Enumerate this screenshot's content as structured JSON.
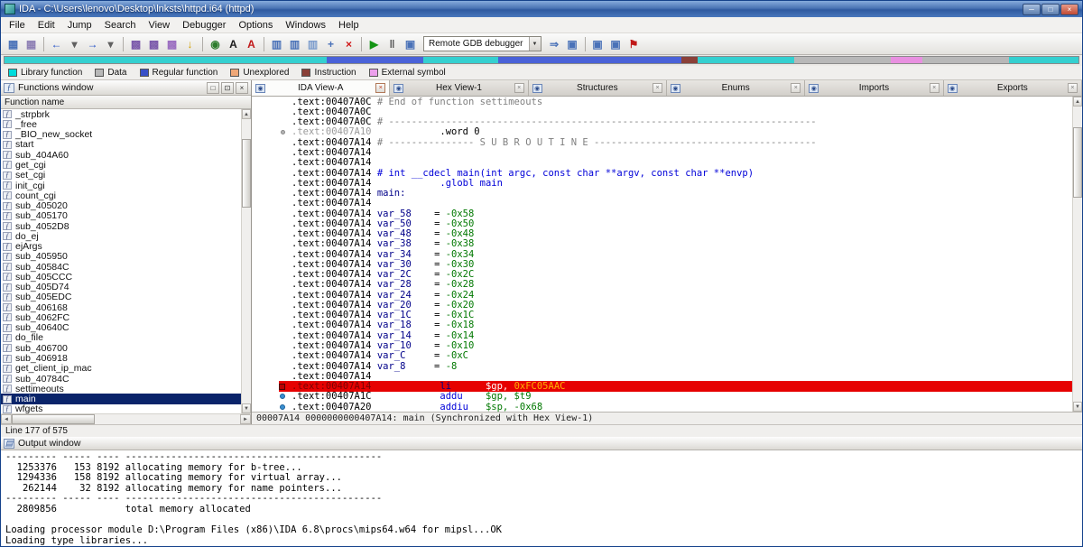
{
  "window": {
    "title": "IDA - C:\\Users\\lenovo\\Desktop\\lnksts\\httpd.i64 (httpd)",
    "controls": [
      {
        "name": "minimize-button",
        "glyph": "─"
      },
      {
        "name": "maximize-button",
        "glyph": "□"
      },
      {
        "name": "close-button",
        "glyph": "×"
      }
    ]
  },
  "menu": {
    "items": [
      "File",
      "Edit",
      "Jump",
      "Search",
      "View",
      "Debugger",
      "Options",
      "Windows",
      "Help"
    ]
  },
  "toolbar": {
    "debugger_combo": {
      "label": "Remote GDB debugger",
      "arrow": "▼"
    },
    "items": [
      {
        "name": "open-database-icon",
        "glyph": "▦",
        "color": "#4a72b8"
      },
      {
        "name": "save-database-icon",
        "glyph": "▦",
        "color": "#8d7fb4"
      },
      {
        "name": "sep"
      },
      {
        "name": "back-icon",
        "glyph": "←",
        "color": "#2050c8"
      },
      {
        "name": "back-dropdown-icon",
        "glyph": "▾",
        "color": "#606060"
      },
      {
        "name": "forward-icon",
        "glyph": "→",
        "color": "#2050c8"
      },
      {
        "name": "forward-dropdown-icon",
        "glyph": "▾",
        "color": "#606060"
      },
      {
        "name": "sep"
      },
      {
        "name": "segments-icon",
        "glyph": "▩",
        "color": "#7a58aa"
      },
      {
        "name": "names-icon",
        "glyph": "▩",
        "color": "#7a58aa"
      },
      {
        "name": "functions-list-icon",
        "glyph": "▩",
        "color": "#9a6cc0"
      },
      {
        "name": "jump-address-icon",
        "glyph": "↓",
        "color": "#d2a000"
      },
      {
        "name": "sep"
      },
      {
        "name": "graph-view-icon",
        "glyph": "◉",
        "color": "#2d7d2d"
      },
      {
        "name": "text-view-icon",
        "glyph": "A",
        "color": "#1a1a1a"
      },
      {
        "name": "strings-icon",
        "glyph": "A",
        "color": "#c01818"
      },
      {
        "name": "sep"
      },
      {
        "name": "chart-flow-icon",
        "glyph": "▥",
        "color": "#4a72b8"
      },
      {
        "name": "chart-calls-icon",
        "glyph": "▥",
        "color": "#4a72b8"
      },
      {
        "name": "chart-xrefs-icon",
        "glyph": "▥",
        "color": "#7c9ccc"
      },
      {
        "name": "add-structure-icon",
        "glyph": "+",
        "color": "#4a72b8"
      },
      {
        "name": "cancel-icon",
        "glyph": "×",
        "color": "#d01818"
      },
      {
        "name": "sep"
      },
      {
        "name": "run-debugger-icon",
        "glyph": "▶",
        "color": "#149414"
      },
      {
        "name": "pause-debugger-icon",
        "glyph": "‖",
        "color": "#555555"
      },
      {
        "name": "stop-debugger-icon",
        "glyph": "▣",
        "color": "#4a72b8"
      },
      {
        "name": "combo"
      },
      {
        "name": "step-into-icon",
        "glyph": "⇒",
        "color": "#4a72b8"
      },
      {
        "name": "debugger-windows-icon",
        "glyph": "▣",
        "color": "#4a72b8"
      },
      {
        "name": "sep"
      },
      {
        "name": "breakpoints-icon",
        "glyph": "▣",
        "color": "#4a72b8"
      },
      {
        "name": "watches-icon",
        "glyph": "▣",
        "color": "#4a72b8"
      },
      {
        "name": "flag-icon",
        "glyph": "⚑",
        "color": "#c01818"
      }
    ]
  },
  "navband": {
    "segments": [
      {
        "color": "#35d0d0",
        "width": 30
      },
      {
        "color": "#4a62d8",
        "width": 9
      },
      {
        "color": "#35d0d0",
        "width": 7
      },
      {
        "color": "#4a62d8",
        "width": 17
      },
      {
        "color": "#8a4038",
        "width": 1.5
      },
      {
        "color": "#35d0d0",
        "width": 9
      },
      {
        "color": "#b8b8b8",
        "width": 9
      },
      {
        "color": "#e890e0",
        "width": 3
      },
      {
        "color": "#b8b8b8",
        "width": 8
      },
      {
        "color": "#35d0d0",
        "width": 6.5
      }
    ]
  },
  "legend": {
    "items": [
      {
        "label": "Library function",
        "color": "#00dcdc"
      },
      {
        "label": "Data",
        "color": "#b8b8b8"
      },
      {
        "label": "Regular function",
        "color": "#3850c8"
      },
      {
        "label": "Unexplored",
        "color": "#f0a878"
      },
      {
        "label": "Instruction",
        "color": "#8a4038"
      },
      {
        "label": "External symbol",
        "color": "#eca0ec"
      }
    ]
  },
  "scroll": {
    "up": "▲",
    "down": "▼",
    "left": "◄",
    "right": "►"
  },
  "functions": {
    "icon": "ƒ",
    "title": "Functions window",
    "buttons": [
      {
        "name": "dock-button",
        "glyph": "□"
      },
      {
        "name": "restore-button",
        "glyph": "⊡"
      },
      {
        "name": "close-button",
        "glyph": "×"
      }
    ],
    "column_header": "Function name",
    "status": "Line 177 of 575",
    "items": [
      {
        "label": "_strpbrk"
      },
      {
        "label": "_free"
      },
      {
        "label": "_BIO_new_socket"
      },
      {
        "label": "start"
      },
      {
        "label": "sub_404A60"
      },
      {
        "label": "get_cgi"
      },
      {
        "label": "set_cgi"
      },
      {
        "label": "init_cgi"
      },
      {
        "label": "count_cgi"
      },
      {
        "label": "sub_405020"
      },
      {
        "label": "sub_405170"
      },
      {
        "label": "sub_4052D8"
      },
      {
        "label": "do_ej"
      },
      {
        "label": "ejArgs"
      },
      {
        "label": "sub_405950"
      },
      {
        "label": "sub_40584C"
      },
      {
        "label": "sub_405CCC"
      },
      {
        "label": "sub_405D74"
      },
      {
        "label": "sub_405EDC"
      },
      {
        "label": "sub_406168"
      },
      {
        "label": "sub_4062FC"
      },
      {
        "label": "sub_40640C"
      },
      {
        "label": "do_file"
      },
      {
        "label": "sub_406700"
      },
      {
        "label": "sub_406918"
      },
      {
        "label": "get_client_ip_mac"
      },
      {
        "label": "sub_40784C"
      },
      {
        "label": "settimeouts"
      },
      {
        "label": "main",
        "selected": true
      },
      {
        "label": "wfgets"
      }
    ]
  },
  "tabs": {
    "icon_glyph": "◉",
    "close_glyph": "×",
    "items": [
      {
        "label": "IDA View-A",
        "active": true
      },
      {
        "label": "Hex View-1"
      },
      {
        "label": "Structures"
      },
      {
        "label": "Enums"
      },
      {
        "label": "Imports"
      },
      {
        "label": "Exports"
      }
    ]
  },
  "disasm": {
    "status": "00007A14 0000000000407A14: main (Synchronized with Hex View-1)",
    "lines": [
      {
        "a": ".text:00407A0C",
        "s": [
          [
            " # End of function settimeouts",
            "c-g"
          ]
        ]
      },
      {
        "a": ".text:00407A0C",
        "s": []
      },
      {
        "a": ".text:00407A0C",
        "s": [
          [
            " # ---------------------------------------------------------------------------",
            "c-g"
          ]
        ]
      },
      {
        "a": ".text:00407A10",
        "ac": "dim",
        "m": "dot-gray",
        "s": [
          [
            "            .word 0",
            "c-b"
          ]
        ]
      },
      {
        "a": ".text:00407A14",
        "s": [
          [
            " # --------------- S U B R O U T I N E ---------------------------------------",
            "c-g"
          ]
        ]
      },
      {
        "a": ".text:00407A14",
        "s": []
      },
      {
        "a": ".text:00407A14",
        "s": []
      },
      {
        "a": ".text:00407A14",
        "s": [
          [
            " # int __cdecl main(int argc, const char **argv, const char **envp)",
            "c-pr"
          ]
        ]
      },
      {
        "a": ".text:00407A14",
        "s": [
          [
            "            ",
            "c-b"
          ],
          [
            ".globl main",
            "c-bl"
          ]
        ]
      },
      {
        "a": ".text:00407A14",
        "s": [
          [
            " ",
            "c-b"
          ],
          [
            "main:",
            "c-nm"
          ]
        ]
      },
      {
        "a": ".text:00407A14",
        "s": []
      },
      {
        "a": ".text:00407A14",
        "s": [
          [
            " ",
            "c-b"
          ],
          [
            "var_58",
            "c-nm"
          ],
          [
            "    = ",
            "c-b"
          ],
          [
            "-0x58",
            "c-gr"
          ]
        ]
      },
      {
        "a": ".text:00407A14",
        "s": [
          [
            " ",
            "c-b"
          ],
          [
            "var_50",
            "c-nm"
          ],
          [
            "    = ",
            "c-b"
          ],
          [
            "-0x50",
            "c-gr"
          ]
        ]
      },
      {
        "a": ".text:00407A14",
        "s": [
          [
            " ",
            "c-b"
          ],
          [
            "var_48",
            "c-nm"
          ],
          [
            "    = ",
            "c-b"
          ],
          [
            "-0x48",
            "c-gr"
          ]
        ]
      },
      {
        "a": ".text:00407A14",
        "s": [
          [
            " ",
            "c-b"
          ],
          [
            "var_38",
            "c-nm"
          ],
          [
            "    = ",
            "c-b"
          ],
          [
            "-0x38",
            "c-gr"
          ]
        ]
      },
      {
        "a": ".text:00407A14",
        "s": [
          [
            " ",
            "c-b"
          ],
          [
            "var_34",
            "c-nm"
          ],
          [
            "    = ",
            "c-b"
          ],
          [
            "-0x34",
            "c-gr"
          ]
        ]
      },
      {
        "a": ".text:00407A14",
        "s": [
          [
            " ",
            "c-b"
          ],
          [
            "var_30",
            "c-nm"
          ],
          [
            "    = ",
            "c-b"
          ],
          [
            "-0x30",
            "c-gr"
          ]
        ]
      },
      {
        "a": ".text:00407A14",
        "s": [
          [
            " ",
            "c-b"
          ],
          [
            "var_2C",
            "c-nm"
          ],
          [
            "    = ",
            "c-b"
          ],
          [
            "-0x2C",
            "c-gr"
          ]
        ]
      },
      {
        "a": ".text:00407A14",
        "s": [
          [
            " ",
            "c-b"
          ],
          [
            "var_28",
            "c-nm"
          ],
          [
            "    = ",
            "c-b"
          ],
          [
            "-0x28",
            "c-gr"
          ]
        ]
      },
      {
        "a": ".text:00407A14",
        "s": [
          [
            " ",
            "c-b"
          ],
          [
            "var_24",
            "c-nm"
          ],
          [
            "    = ",
            "c-b"
          ],
          [
            "-0x24",
            "c-gr"
          ]
        ]
      },
      {
        "a": ".text:00407A14",
        "s": [
          [
            " ",
            "c-b"
          ],
          [
            "var_20",
            "c-nm"
          ],
          [
            "    = ",
            "c-b"
          ],
          [
            "-0x20",
            "c-gr"
          ]
        ]
      },
      {
        "a": ".text:00407A14",
        "s": [
          [
            " ",
            "c-b"
          ],
          [
            "var_1C",
            "c-nm"
          ],
          [
            "    = ",
            "c-b"
          ],
          [
            "-0x1C",
            "c-gr"
          ]
        ]
      },
      {
        "a": ".text:00407A14",
        "s": [
          [
            " ",
            "c-b"
          ],
          [
            "var_18",
            "c-nm"
          ],
          [
            "    = ",
            "c-b"
          ],
          [
            "-0x18",
            "c-gr"
          ]
        ]
      },
      {
        "a": ".text:00407A14",
        "s": [
          [
            " ",
            "c-b"
          ],
          [
            "var_14",
            "c-nm"
          ],
          [
            "    = ",
            "c-b"
          ],
          [
            "-0x14",
            "c-gr"
          ]
        ]
      },
      {
        "a": ".text:00407A14",
        "s": [
          [
            " ",
            "c-b"
          ],
          [
            "var_10",
            "c-nm"
          ],
          [
            "    = ",
            "c-b"
          ],
          [
            "-0x10",
            "c-gr"
          ]
        ]
      },
      {
        "a": ".text:00407A14",
        "s": [
          [
            " ",
            "c-b"
          ],
          [
            "var_C",
            "c-nm"
          ],
          [
            "     = ",
            "c-b"
          ],
          [
            "-0xC",
            "c-gr"
          ]
        ]
      },
      {
        "a": ".text:00407A14",
        "s": [
          [
            " ",
            "c-b"
          ],
          [
            "var_8",
            "c-nm"
          ],
          [
            "     = ",
            "c-b"
          ],
          [
            "-8",
            "c-gr"
          ]
        ]
      },
      {
        "a": ".text:00407A14",
        "s": []
      },
      {
        "a": ".text:00407A14",
        "hl": true,
        "m": "sq-red",
        "s": [
          [
            "            ",
            "c-hw"
          ],
          [
            "li      ",
            "c-hm"
          ],
          [
            "$gp, ",
            "c-hw"
          ],
          [
            "0xFC05AAC",
            "c-ho"
          ]
        ]
      },
      {
        "a": ".text:00407A1C",
        "m": "dot-blue",
        "s": [
          [
            "            ",
            "c-b"
          ],
          [
            "addu    ",
            "c-bl"
          ],
          [
            "$gp, $t9",
            "c-gr"
          ]
        ]
      },
      {
        "a": ".text:00407A20",
        "m": "dot-blue",
        "s": [
          [
            "            ",
            "c-b"
          ],
          [
            "addiu   ",
            "c-bl"
          ],
          [
            "$sp, -0x68",
            "c-gr"
          ]
        ]
      }
    ]
  },
  "output": {
    "icon": "▤",
    "title": "Output window",
    "lines": [
      "--------- ----- ---- ---------------------------------------------",
      "  1253376   153 8192 allocating memory for b-tree...",
      "  1294336   158 8192 allocating memory for virtual array...",
      "   262144    32 8192 allocating memory for name pointers...",
      "--------- ----- ---- ---------------------------------------------",
      "  2809856            total memory allocated",
      "",
      "Loading processor module D:\\Program Files (x86)\\IDA 6.8\\procs\\mips64.w64 for mipsl...OK",
      "Loading type libraries..."
    ]
  }
}
